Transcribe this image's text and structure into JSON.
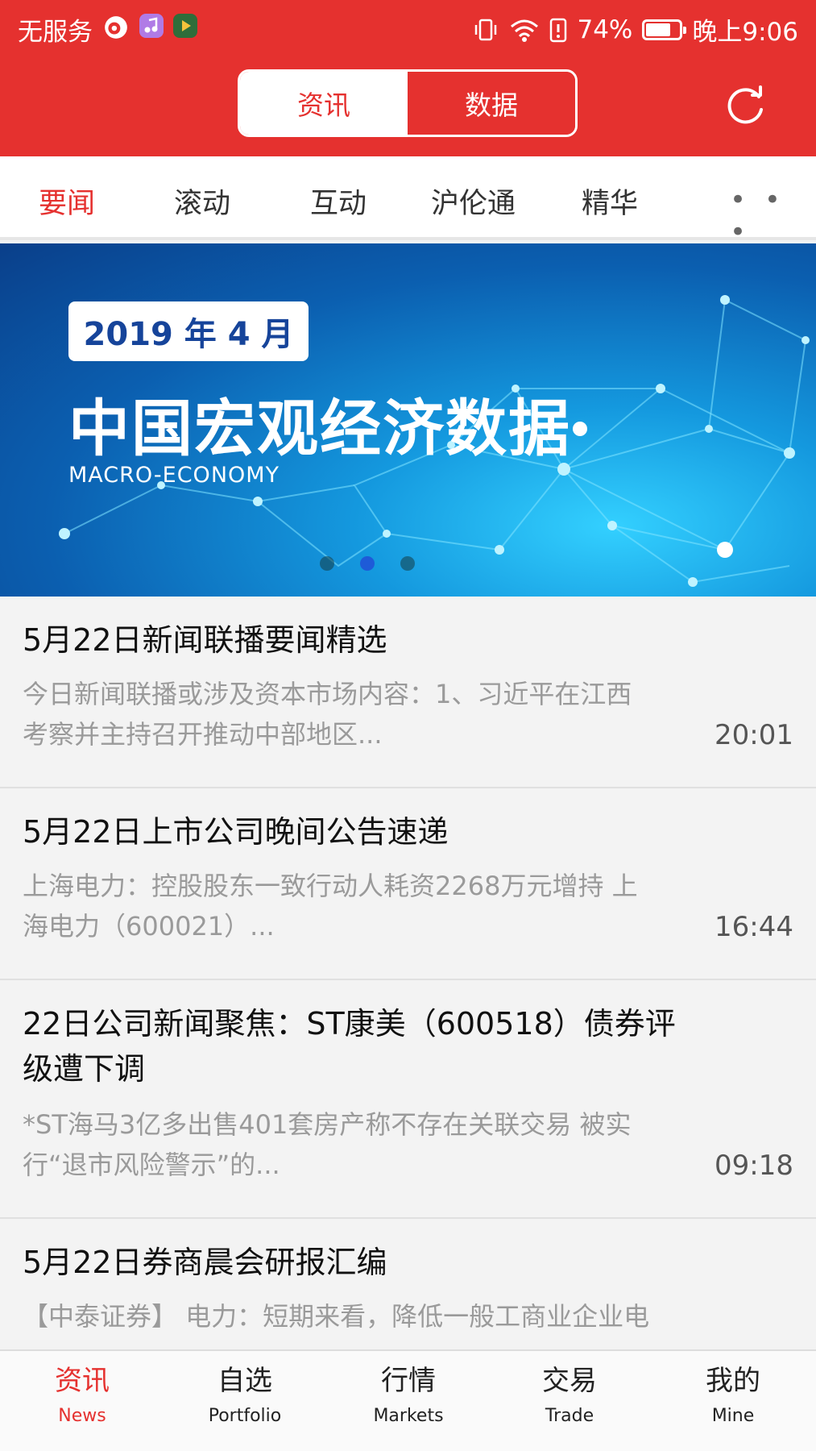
{
  "status_bar": {
    "carrier": "无服务",
    "battery": "74%",
    "battery_level": 0.74,
    "time": "晚上9:06"
  },
  "header": {
    "segments": [
      "资讯",
      "数据"
    ],
    "active_segment": "资讯",
    "refresh_icon": "refresh-icon"
  },
  "tabs": {
    "items": [
      "要闻",
      "滚动",
      "互动",
      "沪伦通",
      "精华"
    ],
    "active": "要闻",
    "more": "• • •"
  },
  "banner": {
    "date": "2019 年 4 月",
    "title": "中国宏观经济数据",
    "subtitle": "MACRO-ECONOMY",
    "page_count": 3,
    "active_page": 2
  },
  "news": [
    {
      "title": "5月22日新闻联播要闻精选",
      "summary_1": "今日新闻联播或涉及资本市场内容：1、习近平在江西",
      "summary_2": "考察并主持召开推动中部地区...",
      "time": "20:01"
    },
    {
      "title": "5月22日上市公司晚间公告速递",
      "summary_1": "上海电力：控股股东一致行动人耗资2268万元增持 上",
      "summary_2": "海电力（600021）...",
      "time": "16:44"
    },
    {
      "title_1": "22日公司新闻聚焦：ST康美（600518）债券评",
      "title_2": "级遭下调",
      "summary_1": "*ST海马3亿多出售401套房产称不存在关联交易 被实",
      "summary_2": "行“退市风险警示”的...",
      "time": "09:18"
    },
    {
      "title": "5月22日券商晨会研报汇编",
      "summary_1": "【中泰证券】 电力：短期来看，降低一般工商业企业电"
    }
  ],
  "bottom_nav": [
    {
      "cn": "资讯",
      "en": "News",
      "active": true
    },
    {
      "cn": "自选",
      "en": "Portfolio",
      "active": false
    },
    {
      "cn": "行情",
      "en": "Markets",
      "active": false
    },
    {
      "cn": "交易",
      "en": "Trade",
      "active": false
    },
    {
      "cn": "我的",
      "en": "Mine",
      "active": false
    }
  ],
  "colors": {
    "brand_red": "#e5312f",
    "banner_blue": "#0b5fb0",
    "text_dark": "#111111",
    "text_gray": "#9a9a9a"
  }
}
